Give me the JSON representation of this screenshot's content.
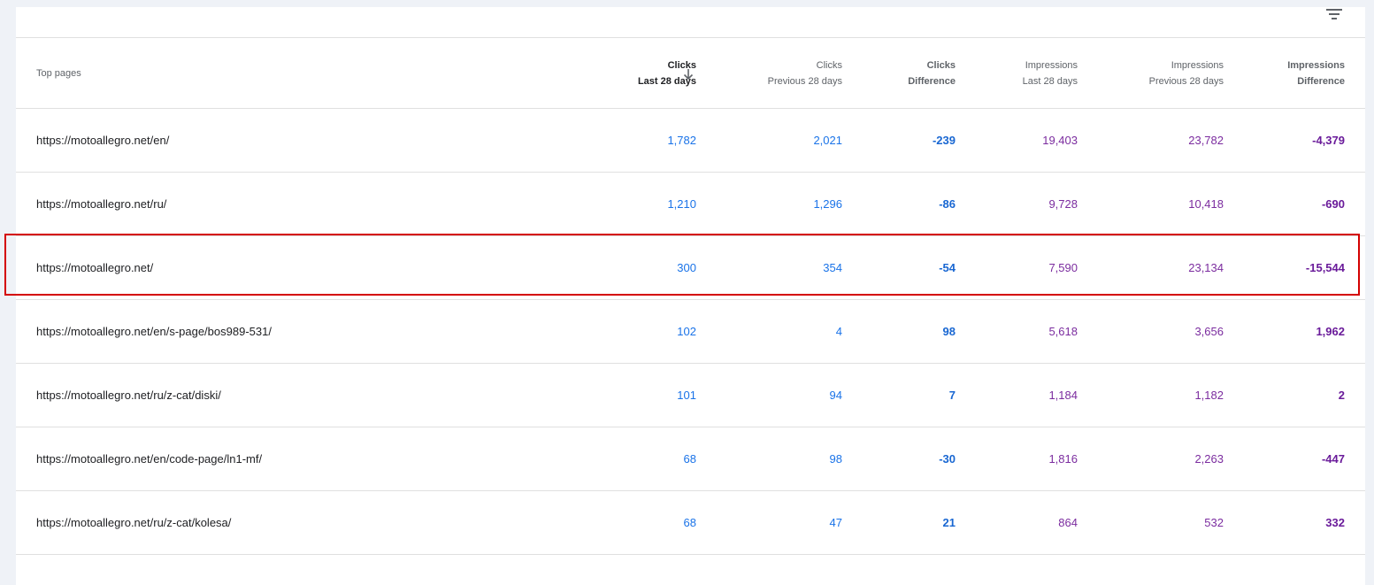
{
  "header": {
    "top_pages": "Top pages",
    "clicks_last_title": "Clicks",
    "clicks_last_sub": "Last 28 days",
    "clicks_prev_title": "Clicks",
    "clicks_prev_sub": "Previous 28 days",
    "clicks_diff_title": "Clicks",
    "clicks_diff_sub": "Difference",
    "impr_last_title": "Impressions",
    "impr_last_sub": "Last 28 days",
    "impr_prev_title": "Impressions",
    "impr_prev_sub": "Previous 28 days",
    "impr_diff_title": "Impressions",
    "impr_diff_sub": "Difference"
  },
  "icons": {
    "filter": "filter-icon",
    "sort": "arrow-down-icon"
  },
  "colors": {
    "clicks": "#1a73e8",
    "impressions": "#7b2c9f",
    "highlight": "#d40000"
  },
  "rows": [
    {
      "page": "https://motoallegro.net/en/",
      "clicks": "1,782",
      "clicks_prev": "2,021",
      "clicks_diff": "-239",
      "impr": "19,403",
      "impr_prev": "23,782",
      "impr_diff": "-4,379"
    },
    {
      "page": "https://motoallegro.net/ru/",
      "clicks": "1,210",
      "clicks_prev": "1,296",
      "clicks_diff": "-86",
      "impr": "9,728",
      "impr_prev": "10,418",
      "impr_diff": "-690"
    },
    {
      "page": "https://motoallegro.net/",
      "clicks": "300",
      "clicks_prev": "354",
      "clicks_diff": "-54",
      "impr": "7,590",
      "impr_prev": "23,134",
      "impr_diff": "-15,544"
    },
    {
      "page": "https://motoallegro.net/en/s-page/bos989-531/",
      "clicks": "102",
      "clicks_prev": "4",
      "clicks_diff": "98",
      "impr": "5,618",
      "impr_prev": "3,656",
      "impr_diff": "1,962"
    },
    {
      "page": "https://motoallegro.net/ru/z-cat/diski/",
      "clicks": "101",
      "clicks_prev": "94",
      "clicks_diff": "7",
      "impr": "1,184",
      "impr_prev": "1,182",
      "impr_diff": "2"
    },
    {
      "page": "https://motoallegro.net/en/code-page/ln1-mf/",
      "clicks": "68",
      "clicks_prev": "98",
      "clicks_diff": "-30",
      "impr": "1,816",
      "impr_prev": "2,263",
      "impr_diff": "-447"
    },
    {
      "page": "https://motoallegro.net/ru/z-cat/kolesa/",
      "clicks": "68",
      "clicks_prev": "47",
      "clicks_diff": "21",
      "impr": "864",
      "impr_prev": "532",
      "impr_diff": "332"
    }
  ]
}
